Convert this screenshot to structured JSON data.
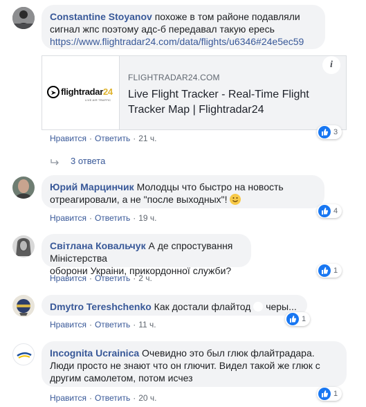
{
  "comments": [
    {
      "author": "Constantine Stoyanov",
      "text_line1": "похоже в том районе подавляли",
      "text_line2": "сигнал жпс поэтому адс-б передавал такую ересь",
      "link": "https://www.flightradar24.com/data/flights/u6346#24e5ec59",
      "card": {
        "domain": "FLIGHTRADAR24.COM",
        "title_line1": "Live Flight Tracker - Real-Time Flight",
        "title_line2": "Tracker Map | Flightradar24",
        "logo_text": "flightradar",
        "logo_num": "24",
        "logo_tagline": "LIVE AIR TRAFFIC",
        "info_label": "i"
      },
      "like": "Нравится",
      "reply": "Ответить",
      "time": "21 ч.",
      "reactions": "3",
      "replies_label": "3 ответа"
    },
    {
      "author": "Юрий Марцинчик",
      "text_line1": "Молодцы что быстро на новость",
      "text_line2": "отреагировали, а не \"после выходных\"!",
      "emoji": "🙂",
      "like": "Нравится",
      "reply": "Ответить",
      "time": "19 ч.",
      "reactions": "4"
    },
    {
      "author": "Світлана Ковальчук",
      "text_line1": "А де спростування Міністерства",
      "text_line2": "оборони Украіни, прикордонної служби?",
      "like": "Нравится",
      "reply": "Ответить",
      "time": "2 ч.",
      "reactions": "1"
    },
    {
      "author": "Dmytro Tereshchenko",
      "text_line1": "Как достали флайтод",
      "text_line1b": "черы...",
      "like": "Нравится",
      "reply": "Ответить",
      "time": "11 ч.",
      "reactions": "1"
    },
    {
      "author": "Incognita Ucrainica",
      "text_line1": "Очевидно это был глюк флайтрадара.",
      "text_line2": "Люди просто не знают что он глючит. Видел такой же глюк с",
      "text_line3": "другим самолетом, потом исчез",
      "like": "Нравится",
      "reply": "Ответить",
      "time": "20 ч.",
      "reactions": "1"
    }
  ],
  "colors": {
    "author": "#385898",
    "bubble": "#f2f3f5",
    "like_blue": "#1877f2",
    "meta": "#606770"
  }
}
